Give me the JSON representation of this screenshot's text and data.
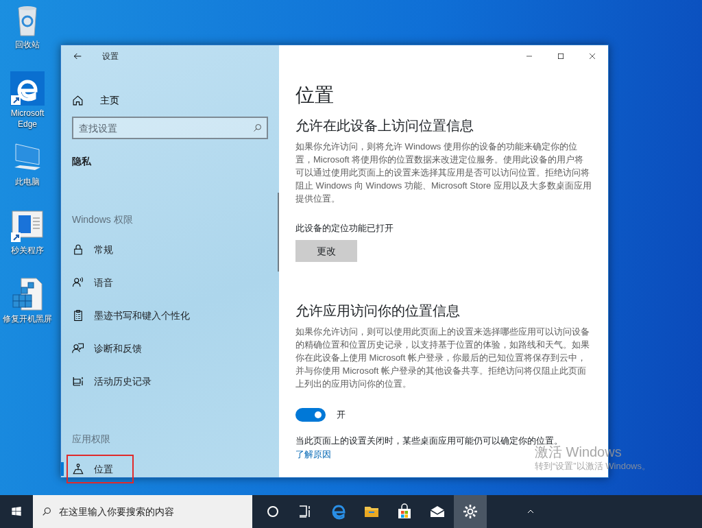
{
  "desktop_icons": [
    {
      "label": "回收站",
      "kind": "recycle",
      "shortcut": false
    },
    {
      "label": "Microsoft Edge",
      "kind": "edge",
      "shortcut": true
    },
    {
      "label": "此电脑",
      "kind": "computer",
      "shortcut": false
    },
    {
      "label": "秒关程序",
      "kind": "app",
      "shortcut": true
    },
    {
      "label": "修复开机黑屏",
      "kind": "registry",
      "shortcut": false
    }
  ],
  "window": {
    "title": "设置",
    "sidebar": {
      "home": "主页",
      "search": {
        "placeholder": "查找设置"
      },
      "section_title": "隐私",
      "groups": [
        {
          "heading": "Windows 权限",
          "items": [
            {
              "label": "常规",
              "kind": "lock",
              "selected": false,
              "highlighted": false
            },
            {
              "label": "语音",
              "kind": "speech",
              "selected": false,
              "highlighted": false
            },
            {
              "label": "墨迹书写和键入个性化",
              "kind": "clipboard",
              "selected": false,
              "highlighted": false
            },
            {
              "label": "诊断和反馈",
              "kind": "feedback",
              "selected": false,
              "highlighted": false
            },
            {
              "label": "活动历史记录",
              "kind": "history",
              "selected": false,
              "highlighted": false
            }
          ]
        },
        {
          "heading": "应用权限",
          "items": [
            {
              "label": "位置",
              "kind": "location",
              "selected": true,
              "highlighted": true
            }
          ]
        }
      ]
    },
    "page": {
      "title": "位置",
      "sections": [
        {
          "heading": "允许在此设备上访问位置信息",
          "description": "如果你允许访问，则将允许 Windows 使用你的设备的功能来确定你的位置，Microsoft 将使用你的位置数据来改进定位服务。使用此设备的用户将可以通过使用此页面上的设置来选择其应用是否可以访问位置。拒绝访问将阻止 Windows 向 Windows 功能、Microsoft Store 应用以及大多数桌面应用提供位置。",
          "kind": "button",
          "status": "此设备的定位功能已打开",
          "button": "更改"
        },
        {
          "heading": "允许应用访问你的位置信息",
          "description": "如果你允许访问，则可以使用此页面上的设置来选择哪些应用可以访问设备的精确位置和位置历史记录，以支持基于位置的体验，如路线和天气。如果你在此设备上使用 Microsoft 帐户登录，你最后的已知位置将保存到云中，并与你使用 Microsoft 帐户登录的其他设备共享。拒绝访问将仅阻止此页面上列出的应用访问你的位置。",
          "kind": "toggle",
          "toggle": {
            "on": true,
            "label": "开"
          },
          "note": "当此页面上的设置关闭时，某些桌面应用可能仍可以确定你的位置。",
          "link": "了解原因"
        }
      ]
    }
  },
  "activation": {
    "title": "激活 Windows",
    "subtitle": "转到“设置”以激活 Windows。"
  },
  "taskbar": {
    "search": {
      "placeholder": "在这里输入你要搜索的内容"
    },
    "apps": [
      {
        "kind": "cortana",
        "selected": false
      },
      {
        "kind": "taskview",
        "selected": false
      },
      {
        "kind": "edge",
        "selected": false
      },
      {
        "kind": "explorer",
        "selected": false
      },
      {
        "kind": "store",
        "selected": false
      },
      {
        "kind": "mail",
        "selected": false
      },
      {
        "kind": "settings",
        "selected": true
      }
    ]
  }
}
